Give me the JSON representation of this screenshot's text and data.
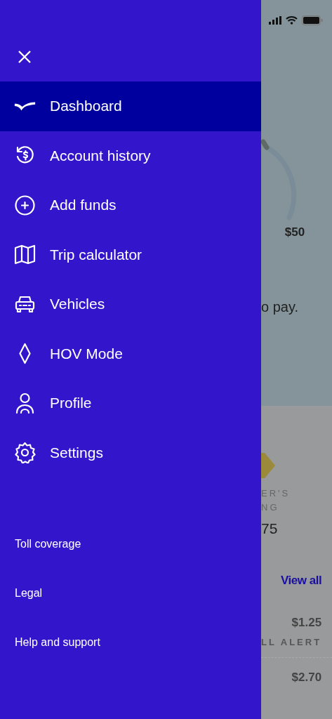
{
  "drawer": {
    "items": [
      {
        "label": "Dashboard",
        "selected": true
      },
      {
        "label": "Account history",
        "selected": false
      },
      {
        "label": "Add funds",
        "selected": false
      },
      {
        "label": "Trip calculator",
        "selected": false
      },
      {
        "label": "Vehicles",
        "selected": false
      },
      {
        "label": "HOV Mode",
        "selected": false
      },
      {
        "label": "Profile",
        "selected": false
      },
      {
        "label": "Settings",
        "selected": false
      }
    ],
    "footer_links": [
      "Toll coverage",
      "Legal",
      "Help and support"
    ]
  },
  "background_screen": {
    "gauge_label": "$50",
    "message": "o pay.",
    "rating_label": [
      "ER'S",
      "NG"
    ],
    "rating_value": "75",
    "link": "View all",
    "transactions": [
      {
        "amount": "$1.25",
        "label": "LL ALERT"
      },
      {
        "amount": "$2.70"
      }
    ]
  }
}
